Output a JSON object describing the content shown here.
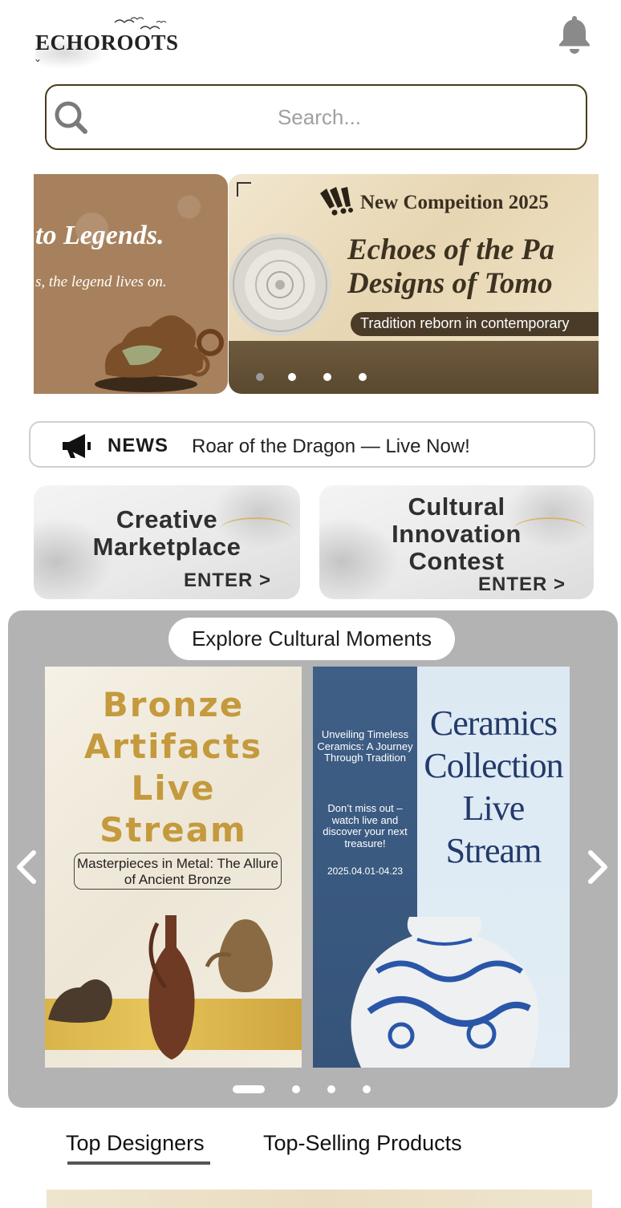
{
  "header": {
    "logo_text": "ECHOROOTS",
    "notification_icon": "bell-icon"
  },
  "search": {
    "placeholder": "Search...",
    "icon": "search-icon"
  },
  "banner": {
    "left_slide": {
      "title": "to  Legends.",
      "subtitle": "s, the legend lives on."
    },
    "main_slide": {
      "competition": "New Compeition 2025",
      "headline_line1": "Echoes of the Pa",
      "headline_line2": "Designs of Tomo",
      "tagline": "Tradition reborn in contemporary"
    },
    "dots_count": 4,
    "active_dot": 0
  },
  "news": {
    "label": "NEWS",
    "message": "Roar of the Dragon — Live Now!",
    "icon": "megaphone-icon"
  },
  "entries": [
    {
      "title": "Creative Marketplace",
      "enter": "ENTER >"
    },
    {
      "title": "Cultural Innovation Contest",
      "enter": "ENTER >"
    }
  ],
  "explore": {
    "heading": "Explore Cultural Moments",
    "posters": [
      {
        "title": "Bronze Artifacts Live Stream",
        "subtitle": "Masterpieces in Metal: The Allure of Ancient Bronze"
      },
      {
        "title": "Ceramics Collection Live Stream",
        "intro": "Unveiling Timeless Ceramics: A Journey Through Tradition",
        "cta": "Don’t miss out – watch live and discover your next treasure!",
        "dates": "2025.04.01-04.23"
      }
    ],
    "dots_count": 4,
    "active_dot": 0
  },
  "tabs": [
    {
      "label": "Top Designers",
      "active": true
    },
    {
      "label": "Top-Selling Products",
      "active": false
    }
  ],
  "colors": {
    "search_border": "#4a3a1e",
    "explore_bg": "#b3b3b3",
    "bronze_gold": "#c49a3d",
    "ceramic_blue": "#233a6a"
  }
}
